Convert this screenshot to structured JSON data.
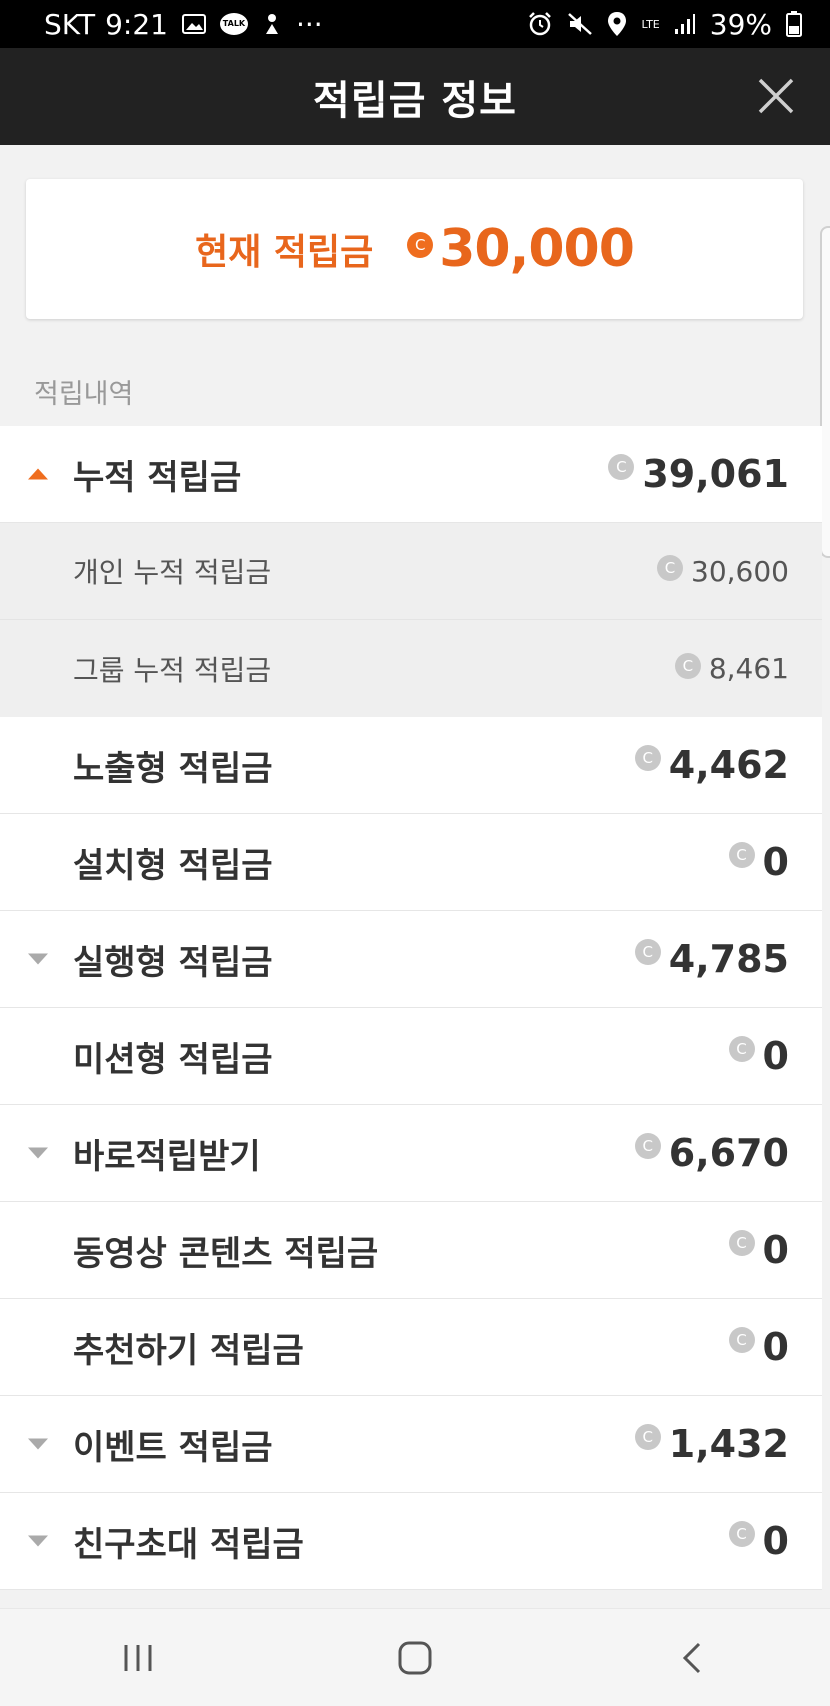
{
  "status_bar": {
    "carrier": "SKT",
    "time": "9:21",
    "talk_icon_text": "TALK",
    "more": "···",
    "network": "LTE",
    "battery": "39%",
    "icons": [
      "image-icon",
      "kakaotalk-icon",
      "download-icon",
      "alarm-icon",
      "mute-icon",
      "location-icon",
      "signal-icon",
      "battery-icon"
    ]
  },
  "header": {
    "title": "적립금 정보",
    "close_icon": "close-icon"
  },
  "current": {
    "label": "현재 적립금",
    "coin_symbol": "C",
    "value": "30,000"
  },
  "section_label": "적립내역",
  "rows": [
    {
      "label": "누적 적립금",
      "amount": "39,061",
      "arrow": "up",
      "type": "main"
    },
    {
      "label": "개인 누적 적립금",
      "amount": "30,600",
      "arrow": "",
      "type": "sub"
    },
    {
      "label": "그룹 누적 적립금",
      "amount": "8,461",
      "arrow": "",
      "type": "sub"
    },
    {
      "label": "노출형 적립금",
      "amount": "4,462",
      "arrow": "",
      "type": "main"
    },
    {
      "label": "설치형 적립금",
      "amount": "0",
      "arrow": "",
      "type": "main"
    },
    {
      "label": "실행형 적립금",
      "amount": "4,785",
      "arrow": "down",
      "type": "main"
    },
    {
      "label": "미션형 적립금",
      "amount": "0",
      "arrow": "",
      "type": "main"
    },
    {
      "label": "바로적립받기",
      "amount": "6,670",
      "arrow": "down",
      "type": "main"
    },
    {
      "label": "동영상 콘텐츠 적립금",
      "amount": "0",
      "arrow": "",
      "type": "main"
    },
    {
      "label": "추천하기 적립금",
      "amount": "0",
      "arrow": "",
      "type": "main"
    },
    {
      "label": "이벤트 적립금",
      "amount": "1,432",
      "arrow": "down",
      "type": "main"
    },
    {
      "label": "친구초대 적립금",
      "amount": "0",
      "arrow": "down",
      "type": "main"
    }
  ],
  "colors": {
    "accent": "#ef6d1e",
    "header_bg": "#222222",
    "coin_gray": "#c8c8c8"
  },
  "navbar": {
    "icons": [
      "recent-apps-icon",
      "home-icon",
      "back-icon"
    ]
  }
}
